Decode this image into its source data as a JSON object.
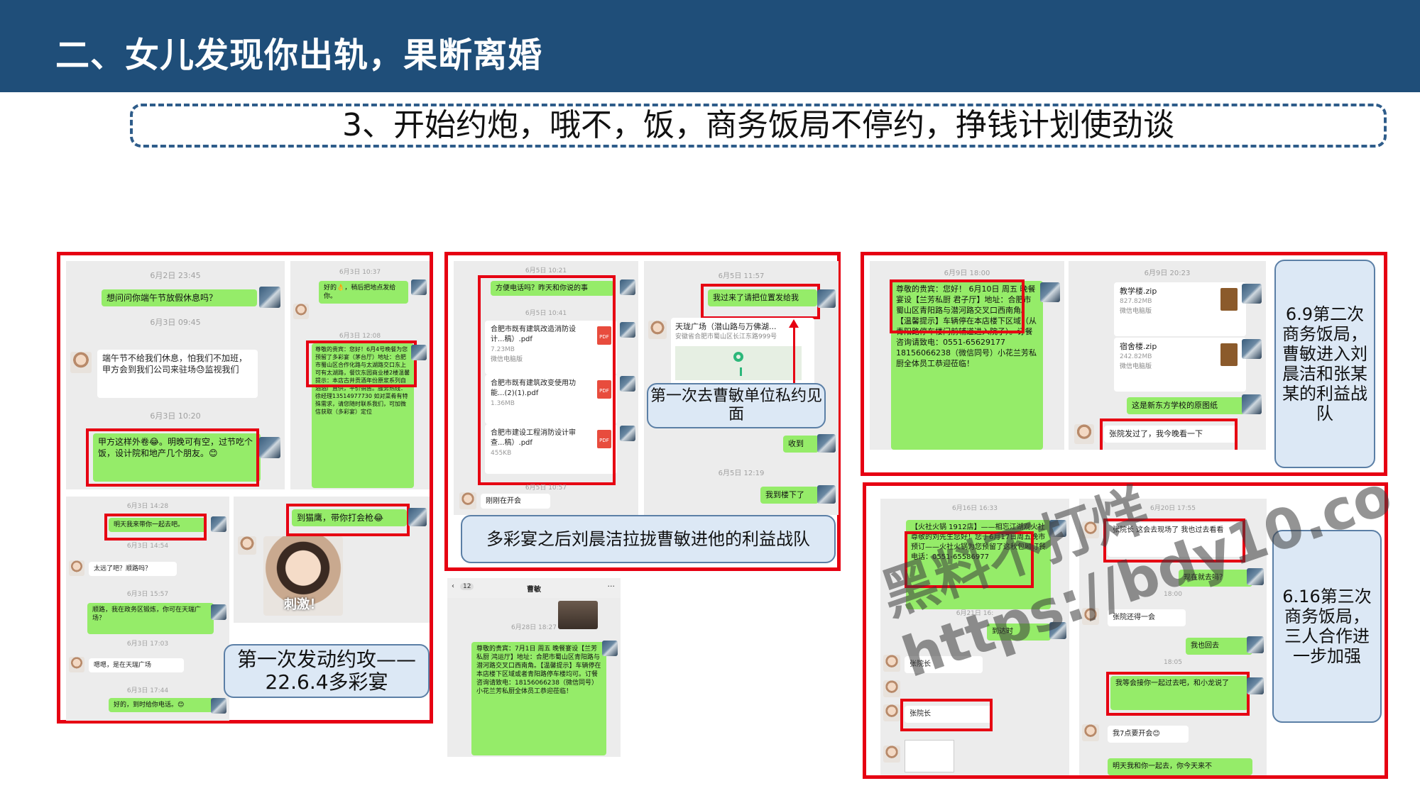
{
  "header": {
    "title": "二、女儿发现你出轨，果断离婚"
  },
  "subtitle": "3、开始约炮，哦不，饭，商务饭局不停约，挣钱计划使劲谈",
  "panel1": {
    "shotA": {
      "time1": "6月2日 23:45",
      "msg1": "想问问你端午节放假休息吗？",
      "time2": "6月3日 09:45",
      "msg2": "端午节不给我们休息，怕我们不加班，甲方会到我们公司来驻场😓监视我们",
      "time3": "6月3日 10:20",
      "msg3": "甲方这样外卷😂。明晚可有空，过节吃个饭，设计院和地产几个朋友。😊"
    },
    "shotB": {
      "time1": "6月3日 10:37",
      "msg1": "好的👌，稍后把地点发给你。",
      "time2": "6月3日 12:08",
      "msg2": "尊敬的贵宾：您好！6月4号晚餐为您预留了多彩宴（茅台厅）地址：合肥市蜀山区合作化路与太湖路交口东上可有太湖路，餐饮东园商业楼2楼温馨提示：本店古井贡酒年份原浆系列自酒酒厂直供，平价销售。服务热线：徐经理13514977730 如对菜肴有特殊需求，请您随时联系我们，可加微信获取（多彩宴）定位"
    },
    "shotC": {
      "time1": "6月3日 14:28",
      "msg1": "明天我来带你一起去吧。",
      "time2": "6月3日 14:54",
      "msg2": "太远了吧？顺路吗？",
      "time3": "6月3日 15:57",
      "msg3": "顺路，我在政务区锻炼，你可在天瑞广场？",
      "time4": "6月3日 17:03",
      "msg4": "嗯嗯，是在天瑞广场",
      "time5": "6月3日 17:44",
      "msg5": "好的，到时给你电话。😊"
    },
    "shotD": {
      "msg1": "到猫鹰，带你打会枪😂",
      "sticker": "刺激！"
    },
    "callout": "第一次发动约攻——22.6.4多彩宴"
  },
  "panel2": {
    "shotA": {
      "time1": "6月5日 10:21",
      "msg1": "方便电话吗？昨天和你说的事",
      "time2": "6月5日 10:41",
      "files": [
        {
          "name": "合肥市既有建筑改造消防设计...稿）.pdf",
          "size": "7.23MB",
          "src": "微信电脑版"
        },
        {
          "name": "合肥市既有建筑改变使用功能...(2)(1).pdf",
          "size": "1.36MB",
          "src": ""
        },
        {
          "name": "合肥市建设工程消防设计审查...稿）.pdf",
          "size": "455KB",
          "src": ""
        }
      ],
      "time3": "6月5日 10:57",
      "msg2": "刚刚在开会"
    },
    "shotB": {
      "time1": "6月5日 11:57",
      "msg1": "我过来了请把位置发给我",
      "location_title": "天珑广场（潜山路与万佛湖...",
      "location_addr": "安徽省合肥市蜀山区长江东路999号",
      "msg2": "收到",
      "time2": "6月5日 12:19",
      "msg3": "我到楼下了"
    },
    "callout": "第一次去曹敏单位私约见面",
    "bottom_callout": "多彩宴之后刘晨洁拉拢曹敏进他的利益战队"
  },
  "panel2b": {
    "nav_back": "12",
    "nav_title": "曹敏",
    "nav_more": "···",
    "time1": "6月28日 18:27",
    "msg1": "尊敬的贵宾：7月1日 周五 晚餐宴设【兰芳私厨 鸿运厅】地址：合肥市蜀山区青阳路与潜河路交叉口西南角。【温馨提示】车辆停在本店楼下区域或者青阳路停车楼均可。订餐咨询请致电：18156066238（微信同号）小花兰芳私厨全体员工恭迎莅临！"
  },
  "panel3": {
    "shotA": {
      "time1": "6月9日 18:00",
      "msg1": "尊敬的贵宾：您好！ 6月10日 周五 晚餐宴设【兰芳私厨 君子厅】地址：合肥市蜀山区青阳路与潜河路交叉口西南角。【温馨提示】车辆停在本店楼下区域（从青阳路停车楼门前辅道进入院子）。订餐咨询请致电：0551-65629177 18156066238（微信同号）小花兰芳私厨全体员工恭迎莅临！"
    },
    "shotB": {
      "time1": "6月9日 20:23",
      "files": [
        {
          "name": "教学楼.zip",
          "size": "827.82MB",
          "src": "微信电脑版"
        },
        {
          "name": "宿舍楼.zip",
          "size": "242.82MB",
          "src": "微信电脑版"
        }
      ],
      "msg1": "这是新东方学校的原图纸",
      "msg2": "张院发过了，我今晚看一下"
    },
    "callout": "6.9第二次商务饭局，曹敏进入刘晨洁和张某某的利益战队"
  },
  "panel4": {
    "shotA": {
      "time1": "6月16日 16:33",
      "msg1": "【火社火锅 1912店】——相忘江湖观火社尊敬的刘先生您好！您于6月17日周五晚市预订——火社火锅为您预留了这秋包厢订餐电话：0551-65586977",
      "time2": "6月21日 16:",
      "msg2": "到达时",
      "msg3": "张院长",
      "msg4": "张院长"
    },
    "shotB": {
      "time1": "6月20日 17:55",
      "msg1": "张院长 这会去现场了 我也过去看看",
      "msg2": "现在就去吗？",
      "time2": "18:00",
      "msg3": "张院还得一会",
      "msg4": "我也回去",
      "time3": "18:05",
      "msg5": "我等会接你一起过去吧，和小龙说了",
      "msg6": "我7点要开会😊",
      "msg7": "明天我和你一起去，你今天来不"
    },
    "callout": "6.16第三次商务饭局，三人合作进一步加强"
  },
  "watermark": "黑料不打烊\nhttps://bdy10.co",
  "colors": {
    "header_bg": "#1f4e79",
    "frame_red": "#e60012",
    "bubble_green": "#95ec69",
    "callout_bg": "#dce8f5"
  }
}
